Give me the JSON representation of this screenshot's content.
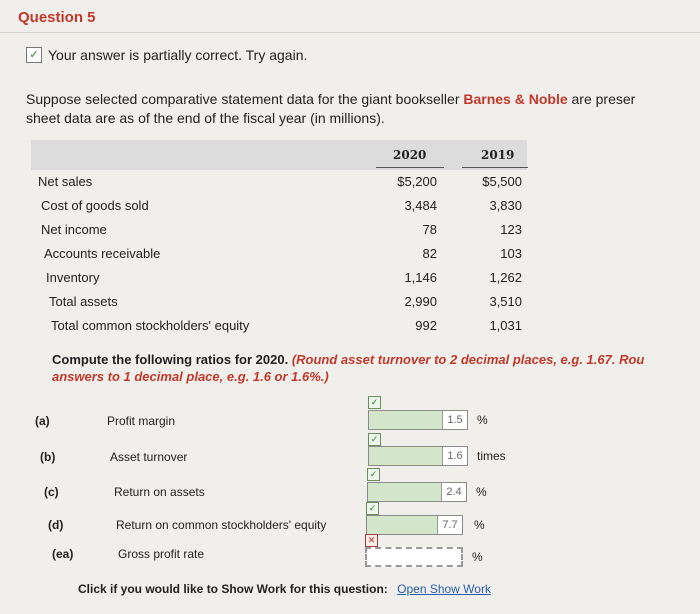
{
  "question": {
    "title": "Question 5"
  },
  "status": {
    "icon": "check-icon",
    "text": "Your answer is partially correct.  Try again."
  },
  "intro": {
    "before_brand": "Suppose selected comparative statement data for the giant bookseller ",
    "brand": "Barnes & Noble",
    "after_brand": " are preser",
    "line2": "sheet data are as of the end of the fiscal year (in millions)."
  },
  "table": {
    "columns": [
      "2020",
      "2019"
    ],
    "rows": [
      {
        "label": "Net sales",
        "v2020": "$5,200",
        "v2019": "$5,500"
      },
      {
        "label": "Cost of goods sold",
        "v2020": "3,484",
        "v2019": "3,830"
      },
      {
        "label": "Net income",
        "v2020": "78",
        "v2019": "123"
      },
      {
        "label": "Accounts receivable",
        "v2020": "82",
        "v2019": "103"
      },
      {
        "label": "Inventory",
        "v2020": "1,146",
        "v2019": "1,262"
      },
      {
        "label": "Total assets",
        "v2020": "2,990",
        "v2019": "3,510"
      },
      {
        "label": "Total common stockholders' equity",
        "v2020": "992",
        "v2019": "1,031"
      }
    ]
  },
  "instructions": {
    "line1_plain": "Compute the following ratios for 2020. ",
    "line1_red": "(Round asset turnover to 2 decimal places, e.g. 1.67. Rou",
    "line2": "answers to 1 decimal place, e.g. 1.6 or 1.6%.)"
  },
  "answers": [
    {
      "letter": "(a)",
      "label": "Profit margin",
      "value": "1.5",
      "unit": "%",
      "correct": true
    },
    {
      "letter": "(b)",
      "label": "Asset turnover",
      "value": "1.6",
      "unit": "times",
      "correct": true
    },
    {
      "letter": "(c)",
      "label": "Return on assets",
      "value": "2.4",
      "unit": "%",
      "correct": true
    },
    {
      "letter": "(d)",
      "label": "Return on common stockholders' equity",
      "value": "7.7",
      "unit": "%",
      "correct": true
    },
    {
      "letter": "(ea)",
      "label": "Gross profit rate",
      "value": "",
      "unit": "%",
      "correct": false
    }
  ],
  "show_work": {
    "prompt": "Click if you would like to Show Work for this question:",
    "link": "Open Show Work"
  }
}
